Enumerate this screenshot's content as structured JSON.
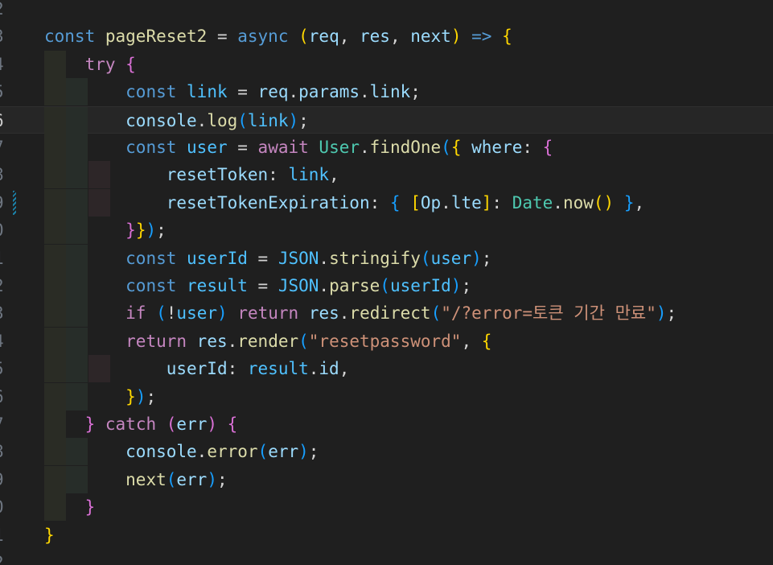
{
  "editor": {
    "lines": [
      {
        "number": "2",
        "tokens": []
      },
      {
        "number": "3",
        "tokens": [
          {
            "t": "const",
            "c": "kw"
          },
          {
            "t": " "
          },
          {
            "t": "pageReset2",
            "c": "fn"
          },
          {
            "t": " = "
          },
          {
            "t": "async",
            "c": "kw"
          },
          {
            "t": " "
          },
          {
            "t": "(",
            "c": "b1"
          },
          {
            "t": "req",
            "c": "var"
          },
          {
            "t": ", "
          },
          {
            "t": "res",
            "c": "var"
          },
          {
            "t": ", "
          },
          {
            "t": "next",
            "c": "var"
          },
          {
            "t": ")",
            "c": "b1"
          },
          {
            "t": " "
          },
          {
            "t": "=>",
            "c": "kw"
          },
          {
            "t": " "
          },
          {
            "t": "{",
            "c": "b1"
          }
        ]
      },
      {
        "number": "4",
        "tokens": [
          {
            "t": "    "
          },
          {
            "t": "try",
            "c": "ctl"
          },
          {
            "t": " "
          },
          {
            "t": "{",
            "c": "b2"
          }
        ]
      },
      {
        "number": "5",
        "tokens": [
          {
            "t": "    "
          },
          {
            "t": "    "
          },
          {
            "t": "const",
            "c": "kw"
          },
          {
            "t": " "
          },
          {
            "t": "link",
            "c": "cst"
          },
          {
            "t": " = "
          },
          {
            "t": "req",
            "c": "var"
          },
          {
            "t": "."
          },
          {
            "t": "params",
            "c": "var"
          },
          {
            "t": "."
          },
          {
            "t": "link",
            "c": "var"
          },
          {
            "t": ";"
          }
        ]
      },
      {
        "number": "6",
        "tokens": [
          {
            "t": "    "
          },
          {
            "t": "    "
          },
          {
            "t": "console",
            "c": "var"
          },
          {
            "t": "."
          },
          {
            "t": "log",
            "c": "fn"
          },
          {
            "t": "(",
            "c": "b3"
          },
          {
            "t": "link",
            "c": "cst"
          },
          {
            "t": ")",
            "c": "b3"
          },
          {
            "t": ";"
          }
        ]
      },
      {
        "number": "7",
        "tokens": [
          {
            "t": "    "
          },
          {
            "t": "    "
          },
          {
            "t": "const",
            "c": "kw"
          },
          {
            "t": " "
          },
          {
            "t": "user",
            "c": "cst"
          },
          {
            "t": " = "
          },
          {
            "t": "await",
            "c": "ctl"
          },
          {
            "t": " "
          },
          {
            "t": "User",
            "c": "cls"
          },
          {
            "t": "."
          },
          {
            "t": "findOne",
            "c": "fn"
          },
          {
            "t": "(",
            "c": "b3"
          },
          {
            "t": "{",
            "c": "b1"
          },
          {
            "t": " "
          },
          {
            "t": "where",
            "c": "var"
          },
          {
            "t": ": "
          },
          {
            "t": "{",
            "c": "b2"
          }
        ]
      },
      {
        "number": "8",
        "tokens": [
          {
            "t": "    "
          },
          {
            "t": "    "
          },
          {
            "t": "    "
          },
          {
            "t": "resetToken",
            "c": "var"
          },
          {
            "t": ": "
          },
          {
            "t": "link",
            "c": "cst"
          },
          {
            "t": ","
          }
        ]
      },
      {
        "number": "9",
        "tokens": [
          {
            "t": "    "
          },
          {
            "t": "    "
          },
          {
            "t": "    "
          },
          {
            "t": "resetTokenExpiration",
            "c": "var"
          },
          {
            "t": ": "
          },
          {
            "t": "{",
            "c": "b3"
          },
          {
            "t": " "
          },
          {
            "t": "[",
            "c": "b1"
          },
          {
            "t": "Op",
            "c": "var"
          },
          {
            "t": "."
          },
          {
            "t": "lte",
            "c": "var"
          },
          {
            "t": "]",
            "c": "b1"
          },
          {
            "t": ": "
          },
          {
            "t": "Date",
            "c": "cls"
          },
          {
            "t": "."
          },
          {
            "t": "now",
            "c": "fn"
          },
          {
            "t": "()",
            "c": "b1"
          },
          {
            "t": " "
          },
          {
            "t": "}",
            "c": "b3"
          },
          {
            "t": ","
          }
        ]
      },
      {
        "number": "0",
        "tokens": [
          {
            "t": "    "
          },
          {
            "t": "    "
          },
          {
            "t": "}",
            "c": "b2"
          },
          {
            "t": "}",
            "c": "b1"
          },
          {
            "t": ")",
            "c": "b3"
          },
          {
            "t": ";"
          }
        ]
      },
      {
        "number": "1",
        "tokens": [
          {
            "t": "    "
          },
          {
            "t": "    "
          },
          {
            "t": "const",
            "c": "kw"
          },
          {
            "t": " "
          },
          {
            "t": "userId",
            "c": "cst"
          },
          {
            "t": " = "
          },
          {
            "t": "JSON",
            "c": "cst"
          },
          {
            "t": "."
          },
          {
            "t": "stringify",
            "c": "fn"
          },
          {
            "t": "(",
            "c": "b3"
          },
          {
            "t": "user",
            "c": "cst"
          },
          {
            "t": ")",
            "c": "b3"
          },
          {
            "t": ";"
          }
        ]
      },
      {
        "number": "2",
        "tokens": [
          {
            "t": "    "
          },
          {
            "t": "    "
          },
          {
            "t": "const",
            "c": "kw"
          },
          {
            "t": " "
          },
          {
            "t": "result",
            "c": "cst"
          },
          {
            "t": " = "
          },
          {
            "t": "JSON",
            "c": "cst"
          },
          {
            "t": "."
          },
          {
            "t": "parse",
            "c": "fn"
          },
          {
            "t": "(",
            "c": "b3"
          },
          {
            "t": "userId",
            "c": "cst"
          },
          {
            "t": ")",
            "c": "b3"
          },
          {
            "t": ";"
          }
        ]
      },
      {
        "number": "3",
        "tokens": [
          {
            "t": "    "
          },
          {
            "t": "    "
          },
          {
            "t": "if",
            "c": "ctl"
          },
          {
            "t": " "
          },
          {
            "t": "(",
            "c": "b3"
          },
          {
            "t": "!"
          },
          {
            "t": "user",
            "c": "cst"
          },
          {
            "t": ")",
            "c": "b3"
          },
          {
            "t": " "
          },
          {
            "t": "return",
            "c": "ctl"
          },
          {
            "t": " "
          },
          {
            "t": "res",
            "c": "var"
          },
          {
            "t": "."
          },
          {
            "t": "redirect",
            "c": "fn"
          },
          {
            "t": "(",
            "c": "b3"
          },
          {
            "t": "\"/?error=토큰 기간 만료\"",
            "c": "str"
          },
          {
            "t": ")",
            "c": "b3"
          },
          {
            "t": ";"
          }
        ]
      },
      {
        "number": "4",
        "tokens": [
          {
            "t": "    "
          },
          {
            "t": "    "
          },
          {
            "t": "return",
            "c": "ctl"
          },
          {
            "t": " "
          },
          {
            "t": "res",
            "c": "var"
          },
          {
            "t": "."
          },
          {
            "t": "render",
            "c": "fn"
          },
          {
            "t": "(",
            "c": "b3"
          },
          {
            "t": "\"resetpassword\"",
            "c": "str"
          },
          {
            "t": ", "
          },
          {
            "t": "{",
            "c": "b1"
          }
        ]
      },
      {
        "number": "5",
        "tokens": [
          {
            "t": "    "
          },
          {
            "t": "    "
          },
          {
            "t": "    "
          },
          {
            "t": "userId",
            "c": "var"
          },
          {
            "t": ": "
          },
          {
            "t": "result",
            "c": "cst"
          },
          {
            "t": "."
          },
          {
            "t": "id",
            "c": "var"
          },
          {
            "t": ","
          }
        ]
      },
      {
        "number": "6",
        "tokens": [
          {
            "t": "    "
          },
          {
            "t": "    "
          },
          {
            "t": "}",
            "c": "b1"
          },
          {
            "t": ")",
            "c": "b3"
          },
          {
            "t": ";"
          }
        ]
      },
      {
        "number": "7",
        "tokens": [
          {
            "t": "    "
          },
          {
            "t": "}",
            "c": "b2"
          },
          {
            "t": " "
          },
          {
            "t": "catch",
            "c": "ctl"
          },
          {
            "t": " "
          },
          {
            "t": "(",
            "c": "b2"
          },
          {
            "t": "err",
            "c": "var"
          },
          {
            "t": ")",
            "c": "b2"
          },
          {
            "t": " "
          },
          {
            "t": "{",
            "c": "b2"
          }
        ]
      },
      {
        "number": "8",
        "tokens": [
          {
            "t": "    "
          },
          {
            "t": "    "
          },
          {
            "t": "console",
            "c": "var"
          },
          {
            "t": "."
          },
          {
            "t": "error",
            "c": "fn"
          },
          {
            "t": "(",
            "c": "b3"
          },
          {
            "t": "err",
            "c": "var"
          },
          {
            "t": ")",
            "c": "b3"
          },
          {
            "t": ";"
          }
        ]
      },
      {
        "number": "9",
        "tokens": [
          {
            "t": "    "
          },
          {
            "t": "    "
          },
          {
            "t": "next",
            "c": "fn"
          },
          {
            "t": "(",
            "c": "b3"
          },
          {
            "t": "err",
            "c": "var"
          },
          {
            "t": ")",
            "c": "b3"
          },
          {
            "t": ";"
          }
        ]
      },
      {
        "number": "0",
        "tokens": [
          {
            "t": "    "
          },
          {
            "t": "}",
            "c": "b2"
          }
        ]
      },
      {
        "number": "1",
        "tokens": [
          {
            "t": "}",
            "c": "b1"
          }
        ]
      },
      {
        "number": "2",
        "tokens": []
      }
    ],
    "active_line_index": 4,
    "modified_line_index": 7,
    "theme": {
      "background": "#1f1f1f",
      "keyword": "#569cd6",
      "control": "#c586c0",
      "variable": "#9cdcfe",
      "function": "#dcdcaa",
      "class": "#4ec9b0",
      "string": "#ce9178",
      "constant": "#4fc1ff",
      "bracket1": "#ffd700",
      "bracket2": "#da70d6",
      "bracket3": "#179fff"
    }
  }
}
